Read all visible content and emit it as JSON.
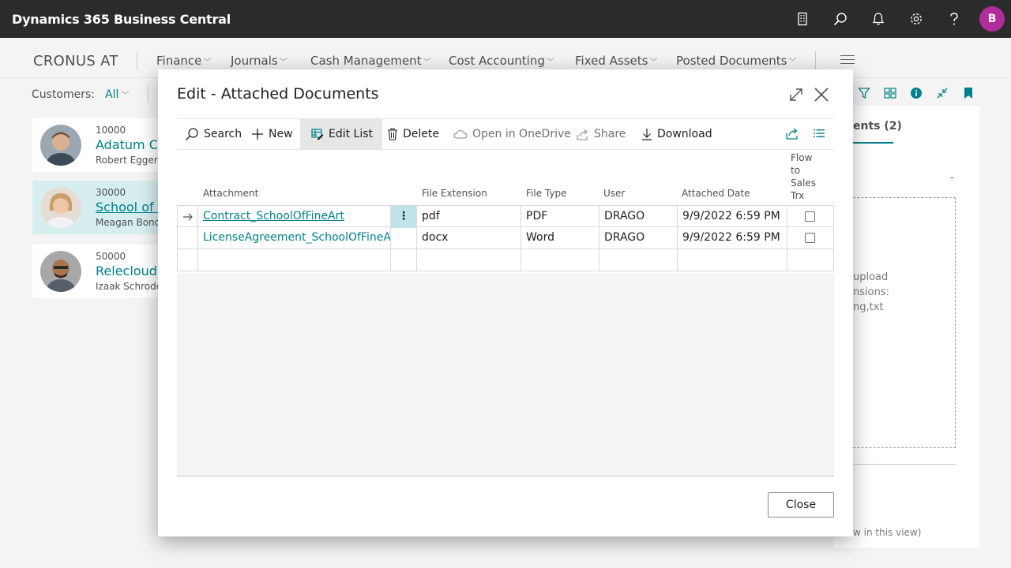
{
  "topbar": {
    "app_title": "Dynamics 365 Business Central",
    "avatar_initial": "B"
  },
  "nav": {
    "company": "CRONUS AT",
    "items": [
      "Finance",
      "Journals",
      "Cash Management",
      "Cost Accounting",
      "Fixed Assets",
      "Posted Documents"
    ]
  },
  "list": {
    "filter_label": "Customers:",
    "filter_value": "All",
    "customers": [
      {
        "no": "10000",
        "name": "Adatum Co",
        "contact": "Robert Egger"
      },
      {
        "no": "30000",
        "name": "School of F",
        "contact": "Meagan Bond"
      },
      {
        "no": "50000",
        "name": "Relecloud",
        "contact": "Izaak Schrode"
      }
    ]
  },
  "right_panel": {
    "tab_label": "ents (2)",
    "dash": "-",
    "drop_lines": [
      "upload",
      "nsions:",
      "ng,txt"
    ],
    "hint": "w in this view)"
  },
  "modal": {
    "title": "Edit - Attached Documents",
    "toolbar": {
      "search": "Search",
      "new": "New",
      "edit_list": "Edit List",
      "delete": "Delete",
      "open_onedrive": "Open in OneDrive",
      "share": "Share",
      "download": "Download"
    },
    "columns": {
      "attachment": "Attachment",
      "file_extension": "File Extension",
      "file_type": "File Type",
      "user": "User",
      "attached_date": "Attached Date",
      "flow_to_sales": [
        "Flow",
        "to",
        "Sales",
        "Trx"
      ]
    },
    "rows": [
      {
        "attachment": "Contract_SchoolOfFineArt",
        "ext": "pdf",
        "type": "PDF",
        "user": "DRAGO",
        "date": "9/9/2022 6:59 PM"
      },
      {
        "attachment": "LicenseAgreement_SchoolOfFineArt",
        "ext": "docx",
        "type": "Word",
        "user": "DRAGO",
        "date": "9/9/2022 6:59 PM"
      }
    ],
    "row_dots": "⋮",
    "close_label": "Close"
  }
}
